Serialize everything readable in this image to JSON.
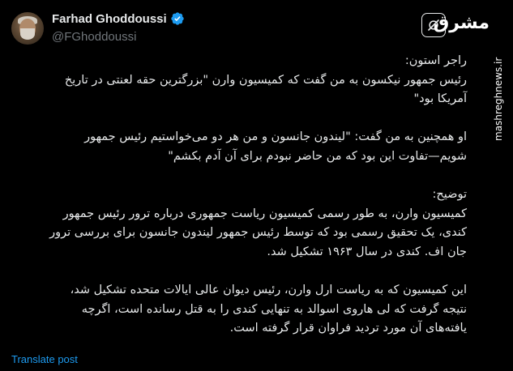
{
  "author": {
    "name": "Farhad Ghoddoussi",
    "handle": "@FGhoddoussi",
    "verified": true
  },
  "brand": {
    "logo_text": "مشرق",
    "watermark": "mashreghnews.ir"
  },
  "post": {
    "paragraphs": [
      {
        "lines": [
          "راجر استون:",
          "رئیس جمهور نیکسون به من گفت که کمیسیون وارن \"بزرگترین حقه لعنتی در تاریخ",
          "آمریکا بود\""
        ]
      },
      {
        "lines": [
          "او همچنین به من گفت: \"لیندون جانسون و من هر دو می‌خواستیم رئیس جمهور",
          "شویم—تفاوت این بود که من حاضر نبودم برای آن آدم بکشم\""
        ]
      },
      {
        "lines": [
          "توضیح:",
          "کمیسیون وارن، به طور رسمی کمیسیون ریاست جمهوری درباره ترور رئیس جمهور",
          "کندی، یک تحقیق رسمی بود که توسط رئیس جمهور لیندون جانسون برای بررسی ترور",
          "جان اف. کندی در سال ۱۹۶۳ تشکیل شد."
        ]
      },
      {
        "lines": [
          "این کمیسیون که به ریاست ارل وارن، رئیس دیوان عالی ایالات متحده تشکیل شد،",
          "نتیجه گرفت که لی هاروی اسوالد به تنهایی کندی را به قتل رسانده است، اگرچه",
          "یافته‌های آن مورد تردید فراوان قرار گرفته است."
        ]
      }
    ]
  },
  "actions": {
    "translate_label": "Translate post"
  },
  "colors": {
    "background": "#000000",
    "text": "#e7e9ea",
    "muted": "#71767b",
    "link": "#1d9bf0",
    "verified": "#1d9bf0"
  },
  "icons": {
    "verified": "verified-badge-icon",
    "grok": "grok-icon"
  }
}
